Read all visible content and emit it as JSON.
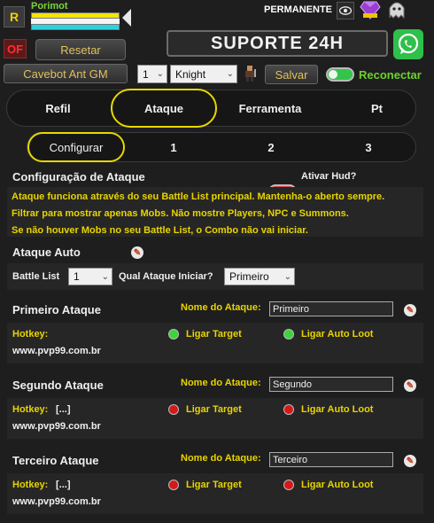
{
  "header": {
    "r_label": "R",
    "character_name": "Porimot",
    "permanente_label": "PERMANENTE",
    "of_label": "OF",
    "resetar_label": "Resetar",
    "suporte_label": "SUPORTE 24H",
    "cavebot_label": "Cavebot Ant GM",
    "slot_value": "1",
    "vocation_value": "Knight",
    "salvar_label": "Salvar",
    "reconectar_label": "Reconectar",
    "reconectar_on": true
  },
  "icons": {
    "eye": "eye-icon",
    "gem": "gem-icon",
    "ghost": "ghost-icon",
    "whatsapp": "whatsapp-icon",
    "character": "character-icon",
    "pin": "pin-icon"
  },
  "main_tabs": [
    {
      "label": "Refil",
      "active": false
    },
    {
      "label": "Ataque",
      "active": true
    },
    {
      "label": "Ferramenta",
      "active": false
    },
    {
      "label": "Pt",
      "active": false
    }
  ],
  "sub_tabs": [
    {
      "label": "Configurar",
      "active": true
    },
    {
      "label": "1",
      "active": false
    },
    {
      "label": "2",
      "active": false
    },
    {
      "label": "3",
      "active": false
    }
  ],
  "config": {
    "title": "Configuração de Ataque",
    "hud_label": "Ativar Hud?",
    "info_lines": [
      "Ataque funciona através do seu Battle List principal. Mantenha-o aberto sempre.",
      "Filtrar para mostrar apenas Mobs. Não mostre Players, NPC e Summons.",
      "Se não houver Mobs no seu Battle List, o Combo não vai iniciar."
    ],
    "ataque_auto_label": "Ataque Auto",
    "battle_list_label": "Battle List",
    "battle_list_value": "1",
    "qual_ataque_label": "Qual Ataque Iniciar?",
    "qual_ataque_value": "Primeiro"
  },
  "attacks": [
    {
      "title": "Primeiro Ataque",
      "name_label": "Nome do Ataque:",
      "name_value": "Primeiro",
      "hotkey_label": "Hotkey:",
      "hotkey_value": "",
      "target_label": "Ligar Target",
      "target_status": "green",
      "loot_label": "Ligar Auto Loot",
      "loot_status": "green",
      "url": "www.pvp99.com.br"
    },
    {
      "title": "Segundo Ataque",
      "name_label": "Nome do Ataque:",
      "name_value": "Segundo",
      "hotkey_label": "Hotkey:",
      "hotkey_value": "[...]",
      "target_label": "Ligar Target",
      "target_status": "red",
      "loot_label": "Ligar Auto Loot",
      "loot_status": "red",
      "url": "www.pvp99.com.br"
    },
    {
      "title": "Terceiro Ataque",
      "name_label": "Nome do Ataque:",
      "name_value": "Terceiro",
      "hotkey_label": "Hotkey:",
      "hotkey_value": "[...]",
      "target_label": "Ligar Target",
      "target_status": "red",
      "loot_label": "Ligar Auto Loot",
      "loot_status": "red",
      "url": "www.pvp99.com.br"
    }
  ]
}
